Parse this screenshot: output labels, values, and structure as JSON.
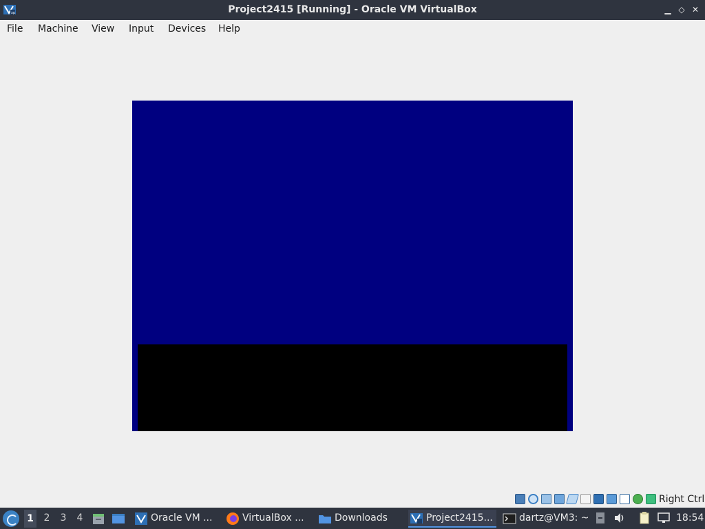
{
  "window": {
    "title": "Project2415 [Running] - Oracle VM VirtualBox",
    "controls": {
      "minimize": "▁",
      "restore": "◇",
      "close": "✕"
    }
  },
  "menu": [
    "File",
    "Machine",
    "View",
    "Input",
    "Devices",
    "Help"
  ],
  "vm": {
    "screen_color": "#000080",
    "console_color": "#000000"
  },
  "status_bar": {
    "icons": [
      "hard-disk-icon",
      "optical-drive-icon",
      "audio-icon",
      "network-icon",
      "usb-icon",
      "shared-folders-icon",
      "display-icon",
      "recording-icon",
      "virtualization-icon",
      "mouse-integration-icon",
      "keyboard-capture-icon"
    ],
    "host_key": "Right Ctrl"
  },
  "taskbar": {
    "workspaces": [
      "1",
      "2",
      "3",
      "4"
    ],
    "active_workspace": "1",
    "tasks": [
      {
        "label": "Oracle VM ...",
        "icon": "virtualbox-icon"
      },
      {
        "label": "VirtualBox ...",
        "icon": "firefox-icon"
      },
      {
        "label": "Downloads",
        "icon": "folder-icon"
      },
      {
        "label": "Project2415...",
        "icon": "virtualbox-vm-icon"
      },
      {
        "label": "dartz@VM3: ~",
        "icon": "terminal-icon"
      }
    ],
    "clock": "18:54"
  }
}
